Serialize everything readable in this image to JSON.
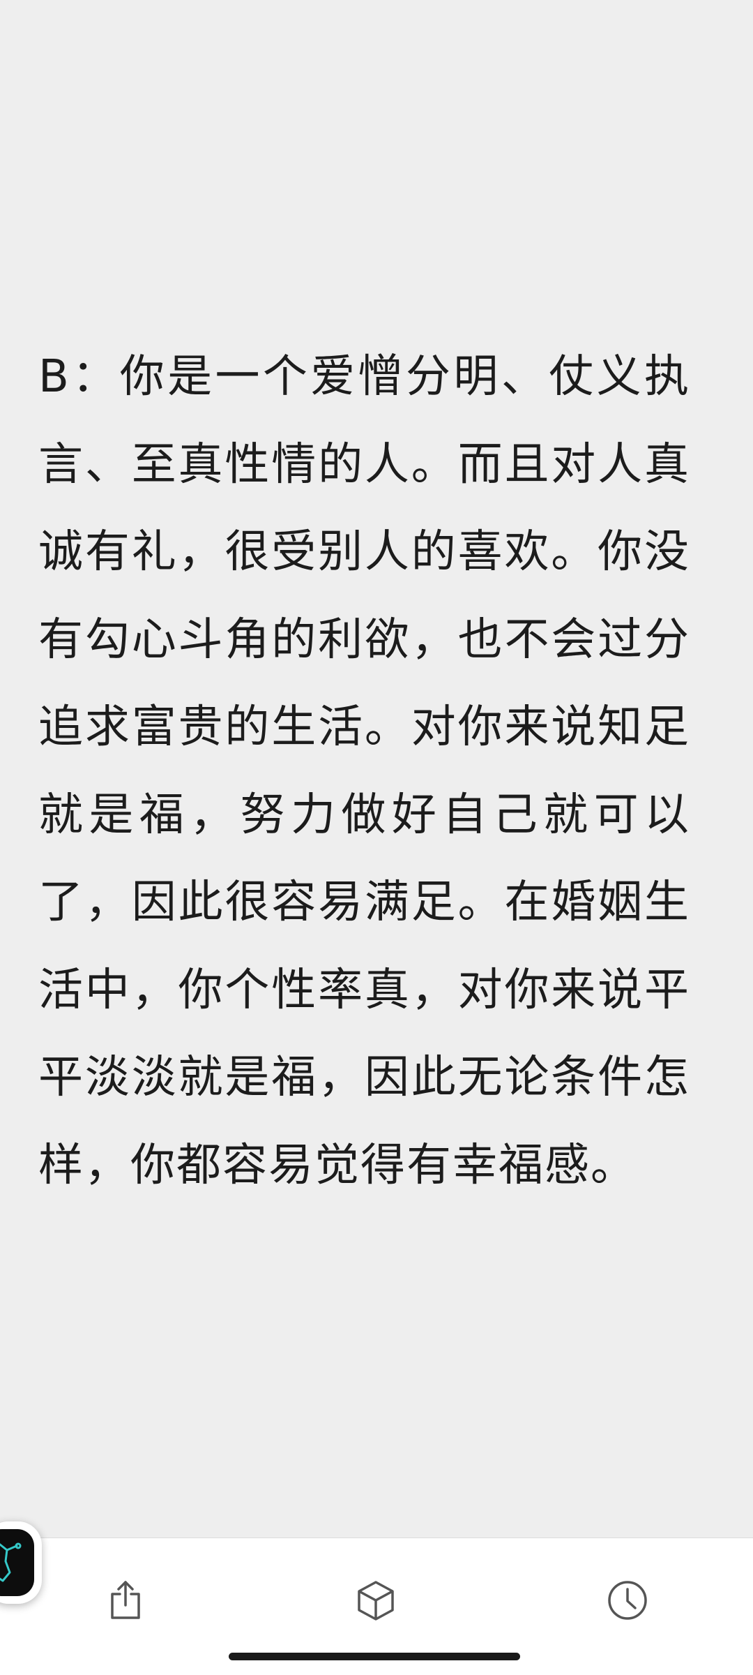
{
  "article": {
    "paragraph": "B：你是一个爱憎分明、仗义执言、至真性情的人。而且对人真诚有礼，很受别人的喜欢。你没有勾心斗角的利欲，也不会过分追求富贵的生活。对你来说知足就是福，努力做好自己就可以了，因此很容易满足。在婚姻生活中，你个性率真，对你来说平平淡淡就是福，因此无论条件怎样，你都容易觉得有幸福感。"
  },
  "toolbar": {
    "icons": [
      "share-icon",
      "cube-icon",
      "clock-icon"
    ]
  },
  "floating_widget": {
    "icon": "app-shortcut-icon"
  },
  "colors": {
    "background": "#eeeeee",
    "text": "#1c1c1c",
    "toolbar_background": "#ffffff",
    "icon": "#555555",
    "widget_accent": "#35c9c9"
  }
}
